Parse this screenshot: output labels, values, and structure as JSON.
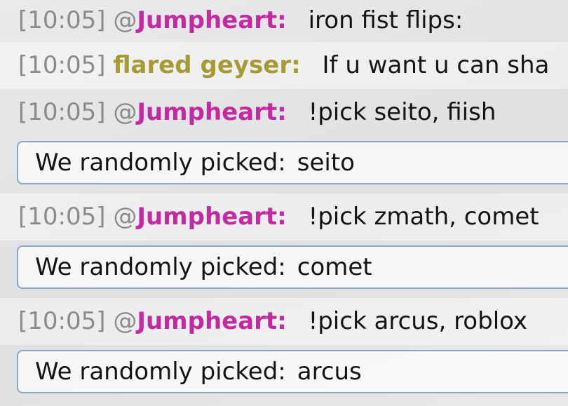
{
  "colors": {
    "jumpheart": "#c22aa0",
    "flared_geyser": "#a69a35",
    "timestamp": "#8b8b8b",
    "bot_border": "#8ea6c4"
  },
  "messages": [
    {
      "time": "[10:05]",
      "at": "@",
      "user": "Jumpheart:",
      "user_color": "#c22aa0",
      "text": "iron fist flips:"
    },
    {
      "time": "[10:05]",
      "at": "",
      "user": "flared geyser:",
      "user_color": "#a69a35",
      "text": "If u want u can sha"
    },
    {
      "time": "[10:05]",
      "at": "@",
      "user": "Jumpheart:",
      "user_color": "#c22aa0",
      "text": "!pick seito, fiish"
    },
    {
      "prefix": "We randomly picked:",
      "value": "seito"
    },
    {
      "time": "[10:05]",
      "at": "@",
      "user": "Jumpheart:",
      "user_color": "#c22aa0",
      "text": "!pick zmath, comet"
    },
    {
      "prefix": "We randomly picked:",
      "value": "comet"
    },
    {
      "time": "[10:05]",
      "at": "@",
      "user": "Jumpheart:",
      "user_color": "#c22aa0",
      "text": "!pick arcus, roblox"
    },
    {
      "prefix": "We randomly picked:",
      "value": "arcus"
    }
  ]
}
